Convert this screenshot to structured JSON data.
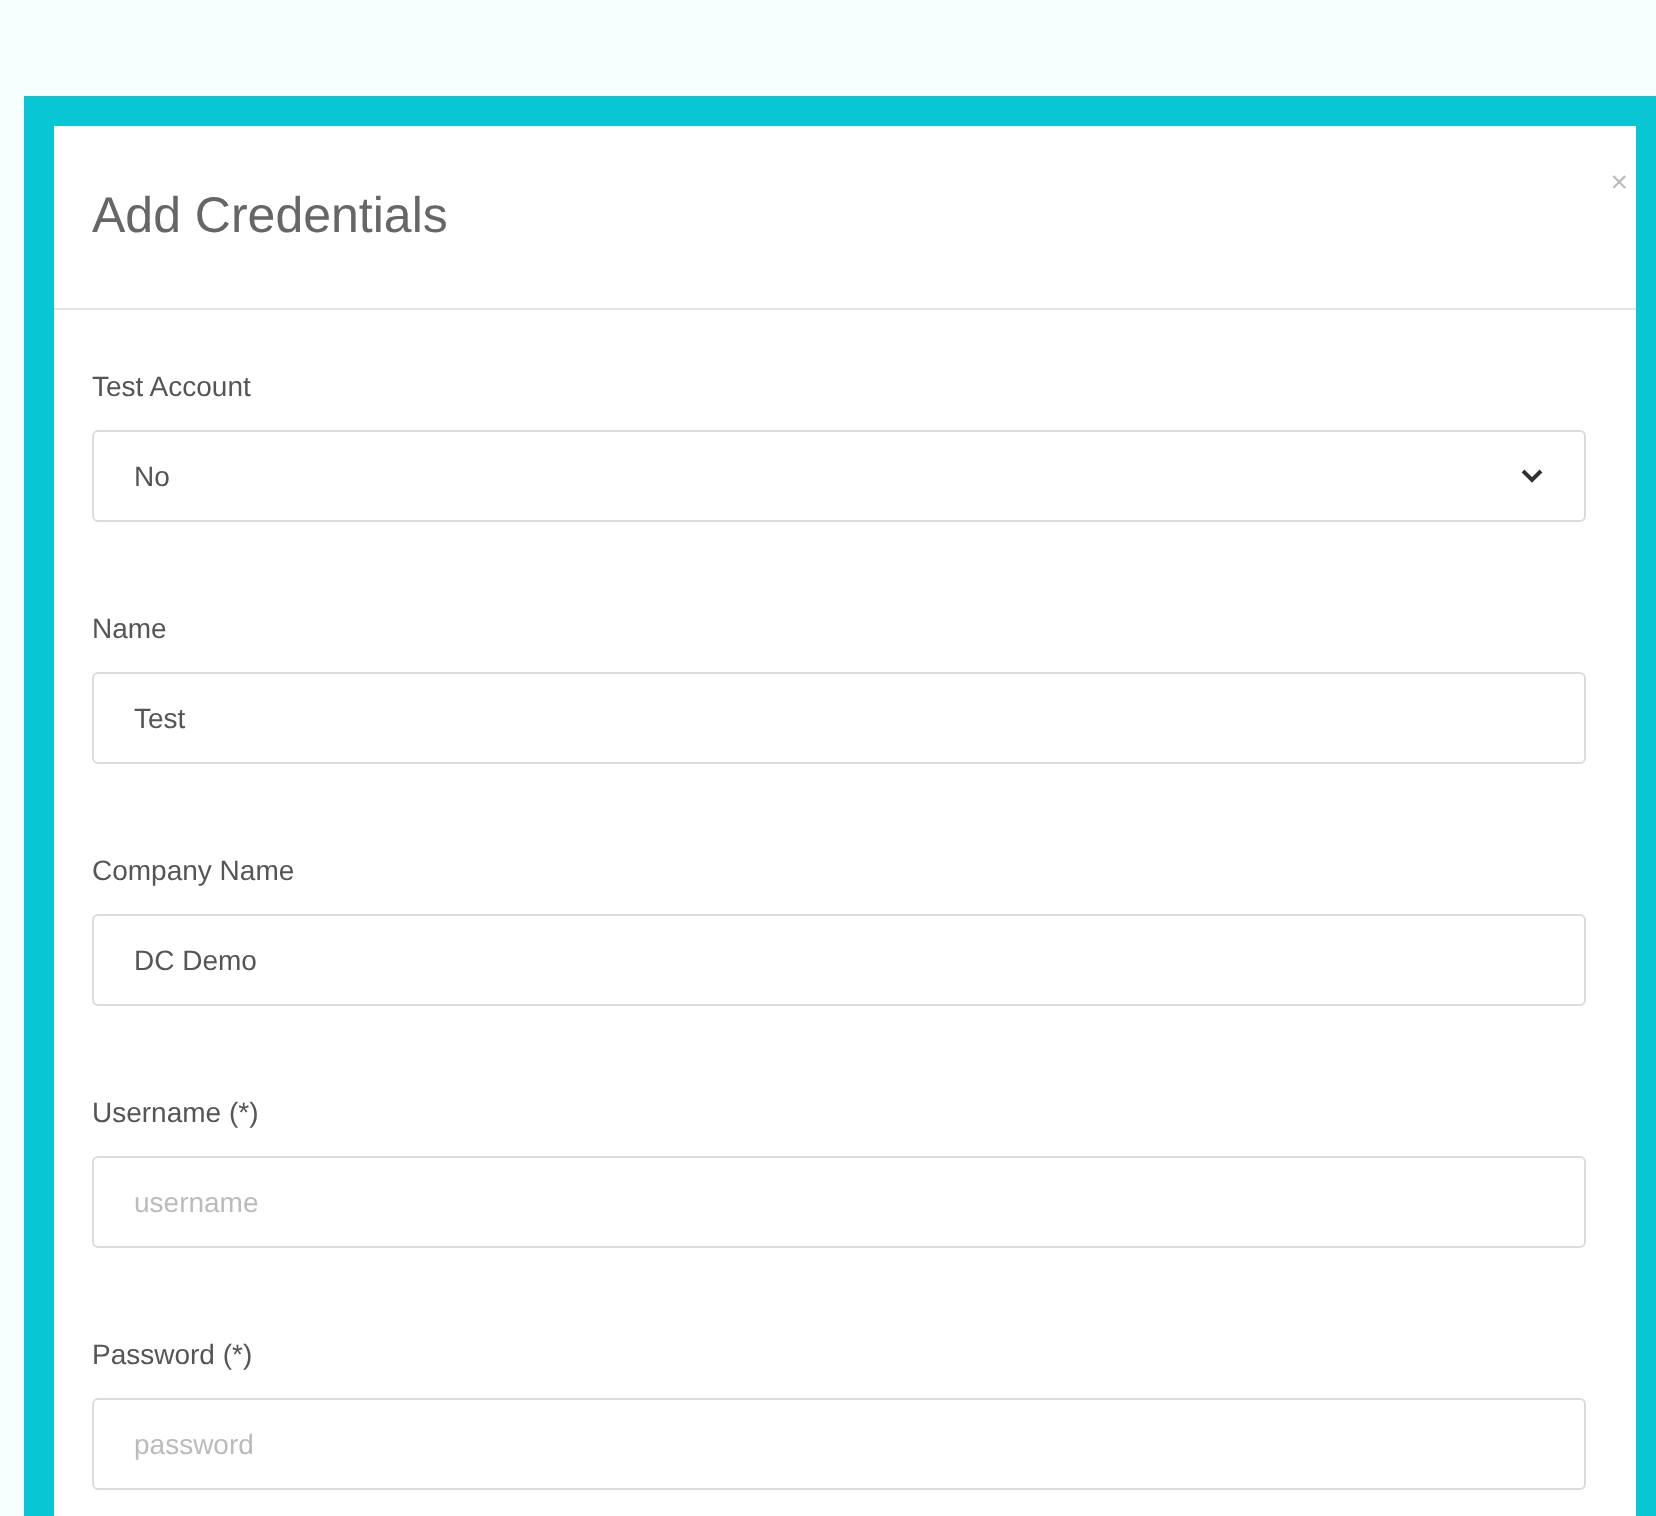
{
  "dialog": {
    "title": "Add Credentials",
    "close": "×"
  },
  "fields": [
    {
      "kind": "select",
      "label": "Test Account",
      "value": "No"
    },
    {
      "kind": "input",
      "label": "Name",
      "value": "Test"
    },
    {
      "kind": "input",
      "label": "Company Name",
      "value": "DC Demo"
    },
    {
      "kind": "input",
      "label": "Username (*)",
      "placeholder": "username"
    },
    {
      "kind": "input",
      "label": "Password (*)",
      "placeholder": "password"
    }
  ]
}
